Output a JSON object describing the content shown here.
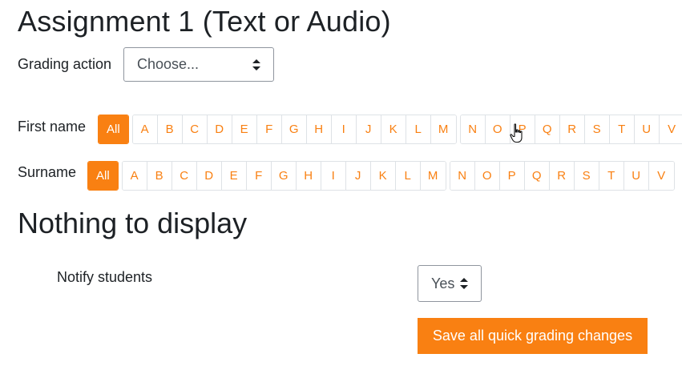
{
  "page": {
    "title": "Assignment 1 (Text or Audio)"
  },
  "grading_action": {
    "label": "Grading action",
    "selected": "Choose..."
  },
  "firstname_bar": {
    "label": "First name",
    "all_label": "All",
    "group1": [
      "A",
      "B",
      "C",
      "D",
      "E",
      "F",
      "G",
      "H",
      "I",
      "J",
      "K",
      "L",
      "M"
    ],
    "group2": [
      "N",
      "O",
      "P",
      "Q",
      "R",
      "S",
      "T",
      "U",
      "V"
    ]
  },
  "surname_bar": {
    "label": "Surname",
    "all_label": "All",
    "group1": [
      "A",
      "B",
      "C",
      "D",
      "E",
      "F",
      "G",
      "H",
      "I",
      "J",
      "K",
      "L",
      "M"
    ],
    "group2": [
      "N",
      "O",
      "P",
      "Q",
      "R",
      "S",
      "T",
      "U",
      "V"
    ]
  },
  "empty_state": {
    "message": "Nothing to display"
  },
  "notify": {
    "label": "Notify students",
    "selected": "Yes"
  },
  "save_button": {
    "label": "Save all quick grading changes"
  },
  "colors": {
    "accent": "#f98012",
    "text": "#1d2125",
    "border": "#dee2e6"
  },
  "icons": {
    "select_arrows": "sort-arrows-icon",
    "cursor": "hand-pointer-icon"
  }
}
